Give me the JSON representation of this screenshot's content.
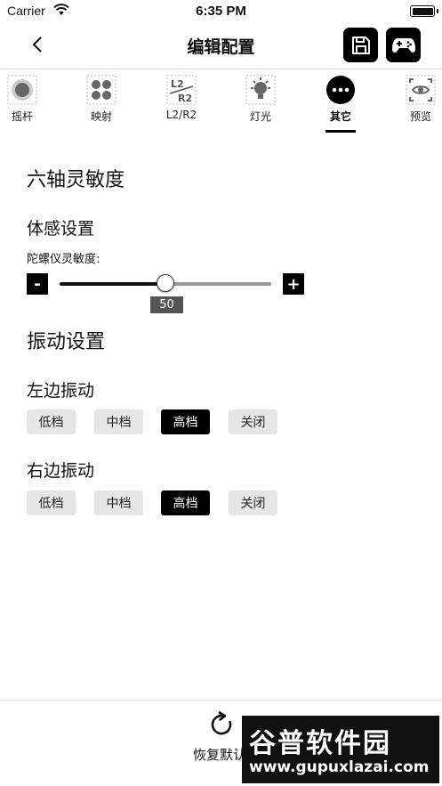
{
  "status_bar": {
    "carrier": "Carrier",
    "time": "6:35 PM"
  },
  "nav": {
    "title": "编辑配置"
  },
  "tabs": [
    {
      "label": "摇杆",
      "icon": "joystick-icon"
    },
    {
      "label": "映射",
      "icon": "mapping-icon"
    },
    {
      "label": "L2/R2",
      "icon": "l2r2-icon",
      "icon_text_top": "L2",
      "icon_text_bottom": "R2"
    },
    {
      "label": "灯光",
      "icon": "light-icon"
    },
    {
      "label": "其它",
      "icon": "more-icon",
      "active": true
    },
    {
      "label": "预览",
      "icon": "preview-icon"
    }
  ],
  "six_axis": {
    "heading": "六轴灵敏度",
    "motion_heading": "体感设置",
    "gyro_label": "陀螺仪灵敏度:",
    "minus_label": "-",
    "plus_label": "+",
    "value": "50",
    "fraction": 0.5
  },
  "vibration": {
    "heading": "振动设置",
    "left": {
      "label": "左边振动",
      "options": [
        "低档",
        "中档",
        "高档",
        "关闭"
      ],
      "selected": "高档"
    },
    "right": {
      "label": "右边振动",
      "options": [
        "低档",
        "中档",
        "高档",
        "关闭"
      ],
      "selected": "高档"
    }
  },
  "footer": {
    "reset_label": "恢复默认"
  },
  "watermark": {
    "title": "谷普软件园",
    "url": "www.gupuxlazai.com"
  },
  "colors": {
    "accent": "#000000",
    "option_bg": "#e6e6e6",
    "slider_value_bg": "#555555"
  }
}
